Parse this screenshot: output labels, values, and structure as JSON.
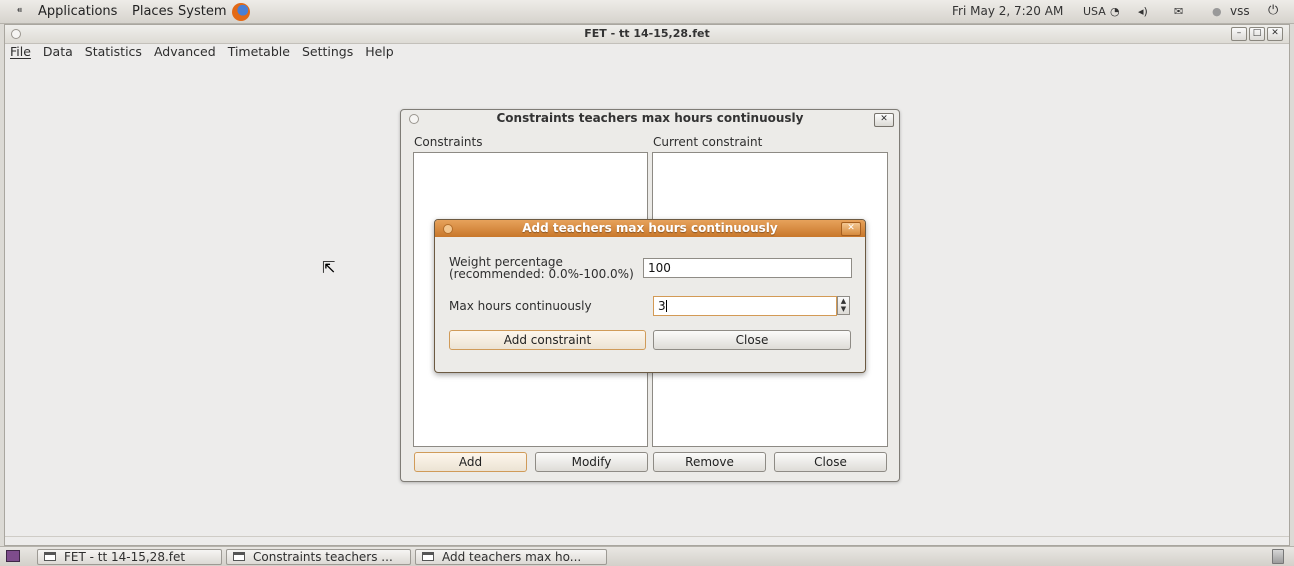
{
  "top_panel": {
    "menus": [
      "Applications",
      "Places",
      "System"
    ],
    "clock": "Fri May 2,  7:20 AM",
    "keyboard_layout": "USA",
    "user": "vss"
  },
  "main_window": {
    "title": "FET - tt 14-15,28.fet",
    "menu": [
      "File",
      "Data",
      "Statistics",
      "Advanced",
      "Timetable",
      "Settings",
      "Help"
    ]
  },
  "constraints_dialog": {
    "title": "Constraints teachers max hours continuously",
    "constraints_label": "Constraints",
    "current_label": "Current constraint",
    "buttons": {
      "add": "Add",
      "modify": "Modify",
      "remove": "Remove",
      "close": "Close"
    }
  },
  "add_dialog": {
    "title": "Add teachers max hours continuously",
    "weight_label_1": "Weight percentage",
    "weight_label_2": "(recommended: 0.0%-100.0%)",
    "weight_value": "100",
    "max_hours_label": "Max hours continuously",
    "max_hours_value": "3",
    "add_button": "Add constraint",
    "close_button": "Close"
  },
  "taskbar": {
    "tasks": [
      "FET - tt 14-15,28.fet",
      "Constraints teachers ...",
      "Add teachers max ho..."
    ]
  },
  "icons": {
    "gnome": "gnome-foot-icon",
    "browser": "firefox-icon",
    "trash": "trash-icon"
  },
  "colors": {
    "accent": "#d0832f",
    "panel": "#dcdad5"
  }
}
